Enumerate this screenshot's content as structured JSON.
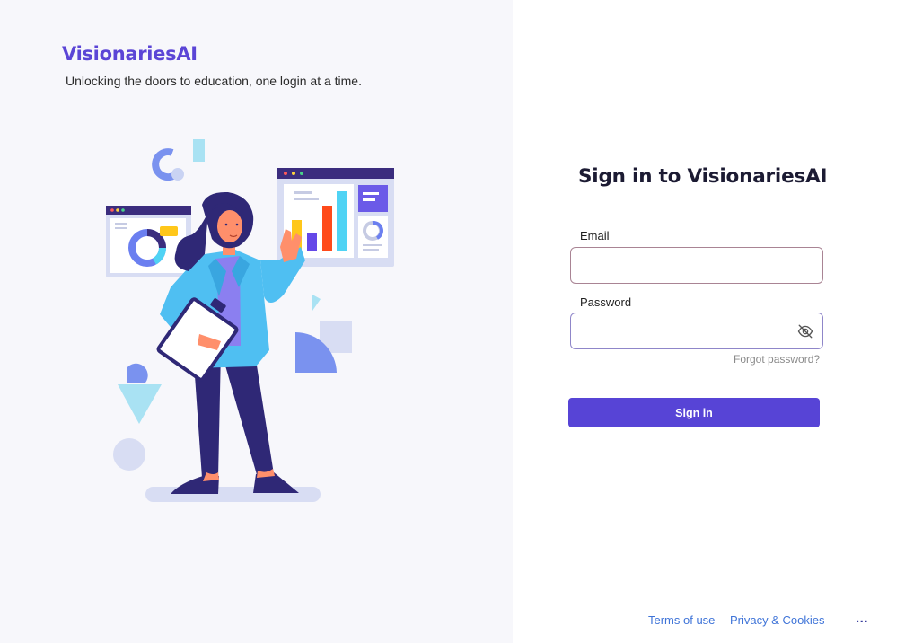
{
  "brand": {
    "name": "VisionariesAI",
    "tagline": "Unlocking the doors to education, one login at a time.",
    "color": "#5b45d6"
  },
  "illustration": {
    "icon": "woman-presenting-dashboard-illustration"
  },
  "signin": {
    "title": "Sign in to VisionariesAI",
    "email_label": "Email",
    "email_value": "",
    "password_label": "Password",
    "password_value": "",
    "password_toggle_icon": "eye-off-icon",
    "forgot_password": "Forgot password?",
    "submit_label": "Sign in",
    "button_color": "#5744d6"
  },
  "footer": {
    "terms": "Terms of use",
    "privacy": "Privacy & Cookies",
    "more": "..."
  }
}
